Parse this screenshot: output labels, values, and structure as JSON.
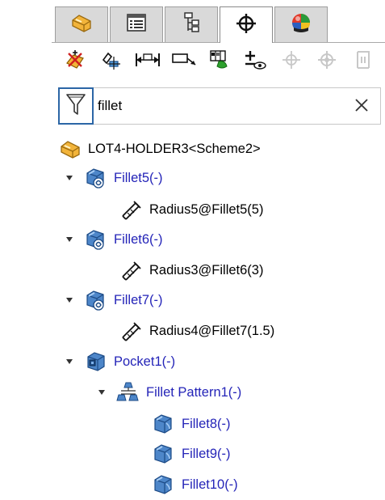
{
  "tabs": [
    {
      "name": "featuremanager-tab",
      "icon": "part-icon",
      "active": false
    },
    {
      "name": "propertymanager-tab",
      "icon": "property-list-icon",
      "active": false
    },
    {
      "name": "configurationmanager-tab",
      "icon": "configuration-icon",
      "active": false
    },
    {
      "name": "dimxpertmanager-tab",
      "icon": "crosshair-icon",
      "active": true
    },
    {
      "name": "displaymanager-tab",
      "icon": "appearance-ball-icon",
      "active": false
    }
  ],
  "toolbar": [
    "auto-dimension-scheme-icon",
    "datum-feature-icon",
    "location-dimension-icon",
    "size-dimension-icon",
    "geometric-tolerance-icon",
    "show-tolerance-status-icon",
    "copy-scheme-icon",
    "tolpost-icon",
    "datum-target-icon"
  ],
  "filter": {
    "value": "fillet",
    "placeholder": ""
  },
  "tree": {
    "root": "LOT4-HOLDER3<Scheme2>",
    "items": [
      {
        "label": "Fillet5(-)",
        "type": "fillet"
      },
      {
        "label": "Radius5@Fillet5(5)",
        "type": "dimension"
      },
      {
        "label": "Fillet6(-)",
        "type": "fillet"
      },
      {
        "label": "Radius3@Fillet6(3)",
        "type": "dimension"
      },
      {
        "label": "Fillet7(-)",
        "type": "fillet"
      },
      {
        "label": "Radius4@Fillet7(1.5)",
        "type": "dimension"
      },
      {
        "label": "Pocket1(-)",
        "type": "pocket"
      },
      {
        "label": "Fillet Pattern1(-)",
        "type": "pattern"
      },
      {
        "label": "Fillet8(-)",
        "type": "fillet-small"
      },
      {
        "label": "Fillet9(-)",
        "type": "fillet-small"
      },
      {
        "label": "Fillet10(-)",
        "type": "fillet-small"
      }
    ]
  },
  "colors": {
    "feature_text": "#2424b8",
    "filter_border": "#2c66a6",
    "tab_inactive": "#d9d9d9"
  }
}
